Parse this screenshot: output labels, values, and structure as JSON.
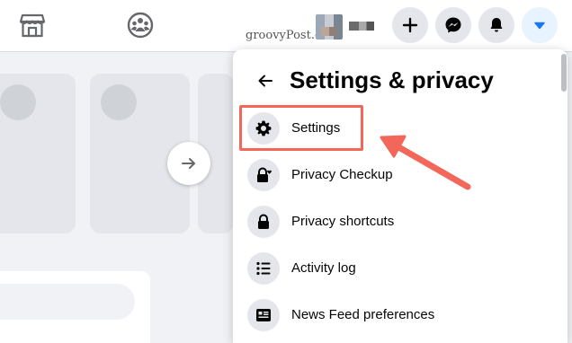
{
  "topbar": {
    "watermark": "groovyPost.com",
    "icons": [
      "marketplace-icon",
      "groups-icon",
      "plus-icon",
      "messenger-icon",
      "bell-icon",
      "caret-down-icon"
    ]
  },
  "menu": {
    "title": "Settings & privacy",
    "items": [
      {
        "label": "Settings",
        "icon": "gear-icon"
      },
      {
        "label": "Privacy Checkup",
        "icon": "lock-heart-icon"
      },
      {
        "label": "Privacy shortcuts",
        "icon": "lock-icon"
      },
      {
        "label": "Activity log",
        "icon": "list-icon"
      },
      {
        "label": "News Feed preferences",
        "icon": "feed-icon"
      }
    ]
  },
  "colors": {
    "annotation": "#f2675a",
    "accent": "#1877f2",
    "background": "#f0f2f5"
  }
}
